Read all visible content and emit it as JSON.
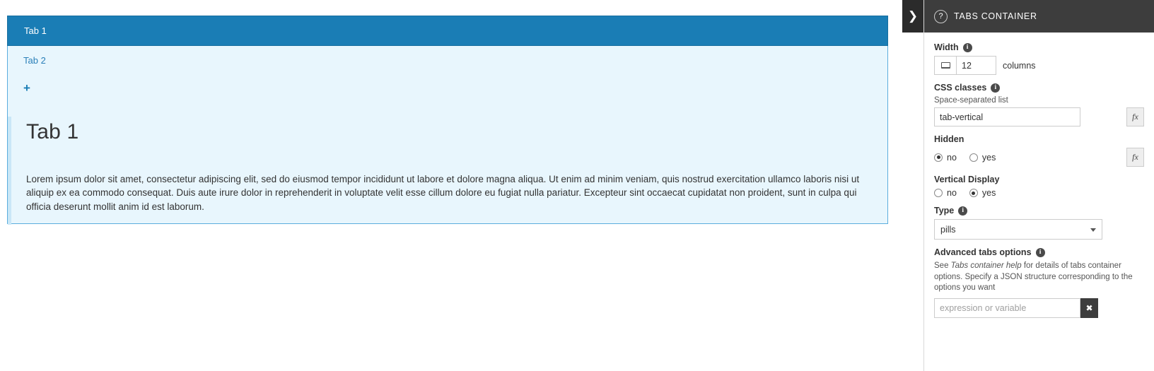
{
  "canvas": {
    "tabs": [
      {
        "label": "Tab 1",
        "active": true
      },
      {
        "label": "Tab 2",
        "active": false
      }
    ],
    "add_tab_label": "+",
    "panel": {
      "heading": "Tab 1",
      "body": "Lorem ipsum dolor sit amet, consectetur adipiscing elit, sed do eiusmod tempor incididunt ut labore et dolore magna aliqua. Ut enim ad minim veniam, quis nostrud exercitation ullamco laboris nisi ut aliquip ex ea commodo consequat. Duis aute irure dolor in reprehenderit in voluptate velit esse cillum dolore eu fugiat nulla pariatur. Excepteur sint occaecat cupidatat non proident, sunt in culpa qui officia deserunt mollit anim id est laborum."
    }
  },
  "sidebar": {
    "toggle_icon": "❯",
    "help_icon": "?",
    "title": "TABS CONTAINER",
    "info_icon": "i",
    "width": {
      "label": "Width",
      "icon": "screen-icon",
      "value": "12",
      "unit": "columns"
    },
    "css_classes": {
      "label": "CSS classes",
      "hint": "Space-separated list",
      "value": "tab-vertical",
      "fx_label": "fx"
    },
    "hidden": {
      "label": "Hidden",
      "options": [
        {
          "label": "no",
          "checked": true
        },
        {
          "label": "yes",
          "checked": false
        }
      ],
      "fx_label": "fx"
    },
    "vertical_display": {
      "label": "Vertical Display",
      "options": [
        {
          "label": "no",
          "checked": false
        },
        {
          "label": "yes",
          "checked": true
        }
      ]
    },
    "type": {
      "label": "Type",
      "value": "pills"
    },
    "advanced": {
      "label": "Advanced tabs options",
      "description_pre": "See ",
      "description_em": "Tabs container help",
      "description_post": " for details of tabs container options. Specify a JSON structure corresponding to the options you want",
      "placeholder": "expression or variable",
      "clear_icon": "✖"
    }
  }
}
